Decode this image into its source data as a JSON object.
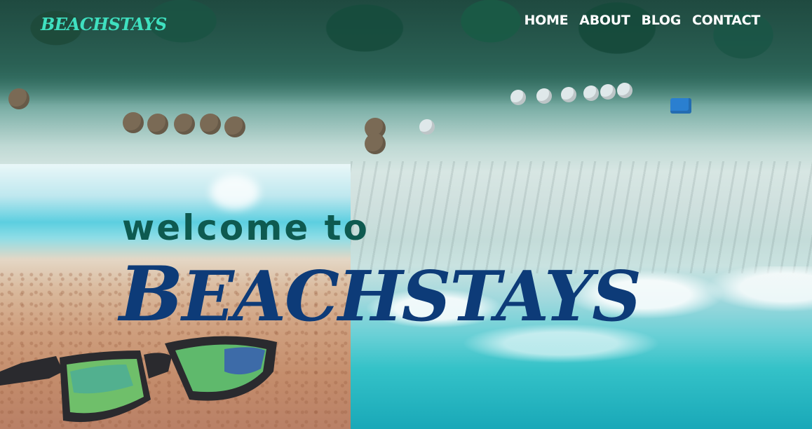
{
  "header": {
    "logo": "BEACHSTAYS",
    "nav": [
      {
        "label": "HOME"
      },
      {
        "label": "ABOUT"
      },
      {
        "label": "BLOG"
      },
      {
        "label": "CONTACT"
      }
    ]
  },
  "hero": {
    "welcome": "welcome to",
    "brand_first": "B",
    "brand_rest": "EACHSTAYS"
  },
  "colors": {
    "logo": "#3fe0c0",
    "welcome": "#0e5a50",
    "brand": "#0d3b78",
    "nav": "#ffffff"
  },
  "icons": {
    "sunglasses": "sunglasses-icon"
  }
}
